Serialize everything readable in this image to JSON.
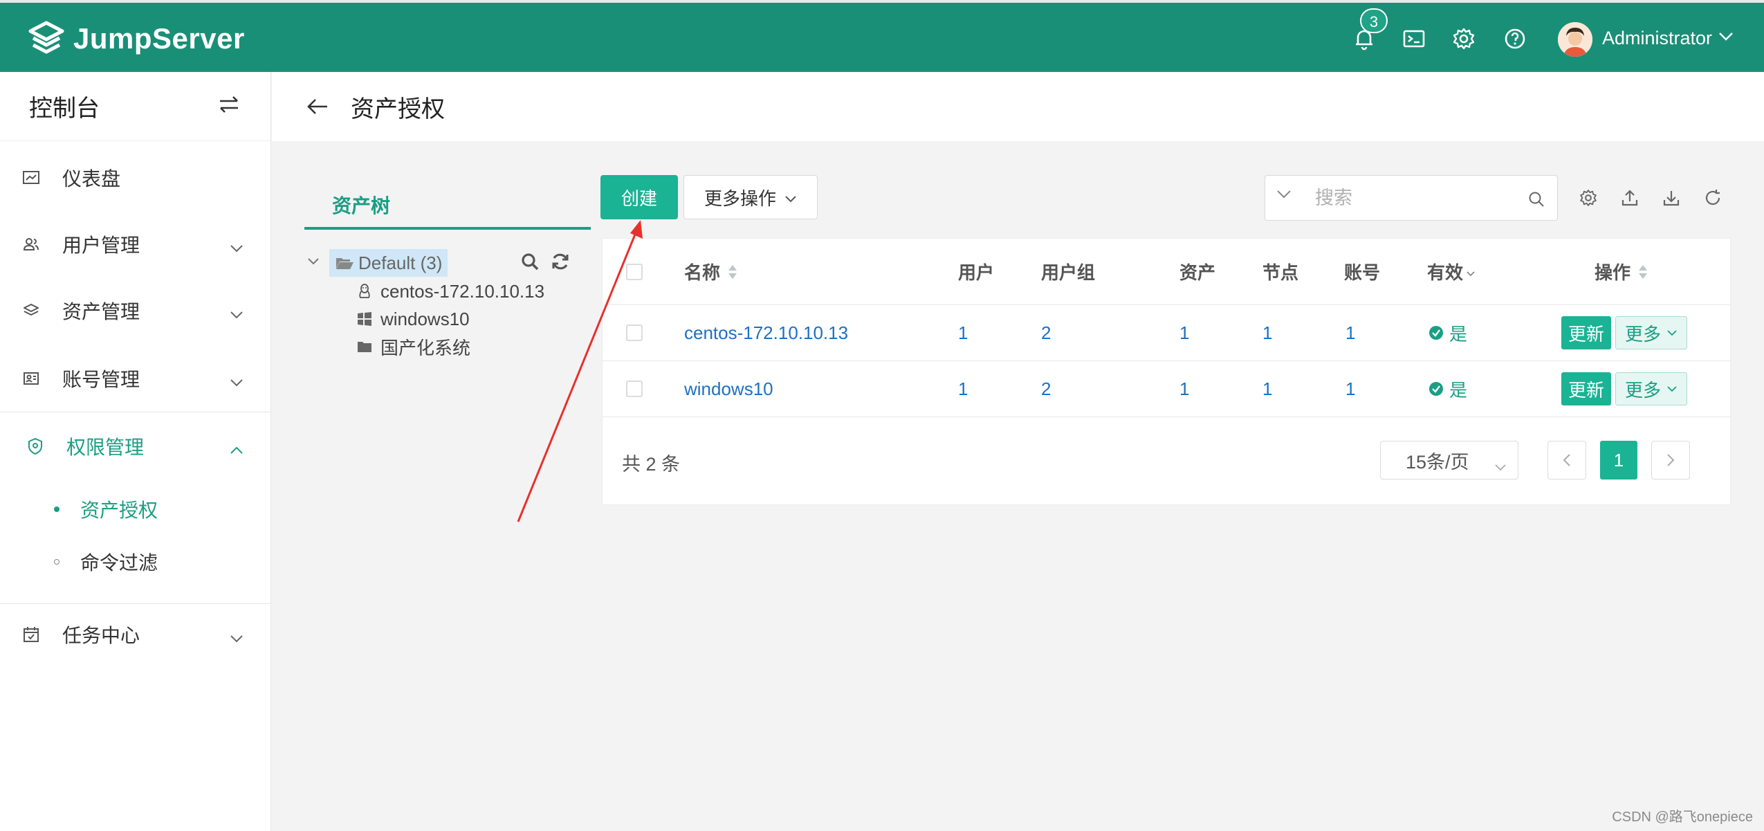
{
  "app": {
    "brand": "JumpServer",
    "notification_count": "3",
    "user_name": "Administrator"
  },
  "sidebar": {
    "title": "控制台",
    "items": [
      {
        "label": "仪表盘",
        "icon": "dashboard-icon"
      },
      {
        "label": "用户管理",
        "icon": "users-icon"
      },
      {
        "label": "资产管理",
        "icon": "layers-icon"
      },
      {
        "label": "账号管理",
        "icon": "account-icon"
      },
      {
        "label": "权限管理",
        "icon": "shield-icon"
      },
      {
        "label": "任务中心",
        "icon": "calendar-icon"
      }
    ],
    "sub_items": [
      {
        "label": "资产授权"
      },
      {
        "label": "命令过滤"
      }
    ]
  },
  "page": {
    "title": "资产授权"
  },
  "tree": {
    "tab_label": "资产树",
    "root": "Default (3)",
    "children": [
      "centos-172.10.10.13",
      "windows10",
      "国产化系统"
    ]
  },
  "toolbar": {
    "create_label": "创建",
    "more_label": "更多操作",
    "search_placeholder": "搜索"
  },
  "table": {
    "headers": {
      "name": "名称",
      "users": "用户",
      "user_groups": "用户组",
      "assets": "资产",
      "nodes": "节点",
      "accounts": "账号",
      "valid": "有效",
      "actions": "操作"
    },
    "rows": [
      {
        "name": "centos-172.10.10.13",
        "users": "1",
        "user_groups": "2",
        "assets": "1",
        "nodes": "1",
        "accounts": "1",
        "valid": "是",
        "update": "更新",
        "more": "更多"
      },
      {
        "name": "windows10",
        "users": "1",
        "user_groups": "2",
        "assets": "1",
        "nodes": "1",
        "accounts": "1",
        "valid": "是",
        "update": "更新",
        "more": "更多"
      }
    ]
  },
  "pagination": {
    "total": "共 2 条",
    "page_size": "15条/页",
    "current_page": "1"
  },
  "watermark": "CSDN @路飞onepiece",
  "colors": {
    "topbar": "#1a8f77",
    "accent": "#1ab394",
    "link": "#1c71c2",
    "annotation_arrow": "#e8302a"
  }
}
